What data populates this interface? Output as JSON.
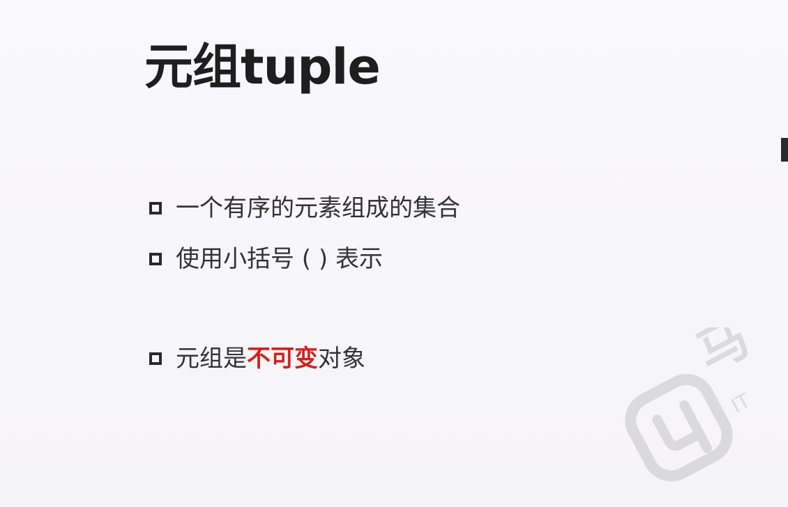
{
  "slide": {
    "title": "元组tuple",
    "bullets": [
      {
        "text": "一个有序的元素组成的集合"
      },
      {
        "text": "使用小括号 ( ) 表示"
      },
      {
        "prefix": "元组是",
        "highlight": "不可变",
        "suffix": "对象"
      }
    ],
    "colors": {
      "background": "#f7f6f8",
      "title": "#1e1e1e",
      "text": "#333333",
      "highlight": "#d61f1f"
    },
    "watermark": {
      "icon": "brand-logo-icon",
      "text": "马",
      "subtext": "IT"
    }
  }
}
